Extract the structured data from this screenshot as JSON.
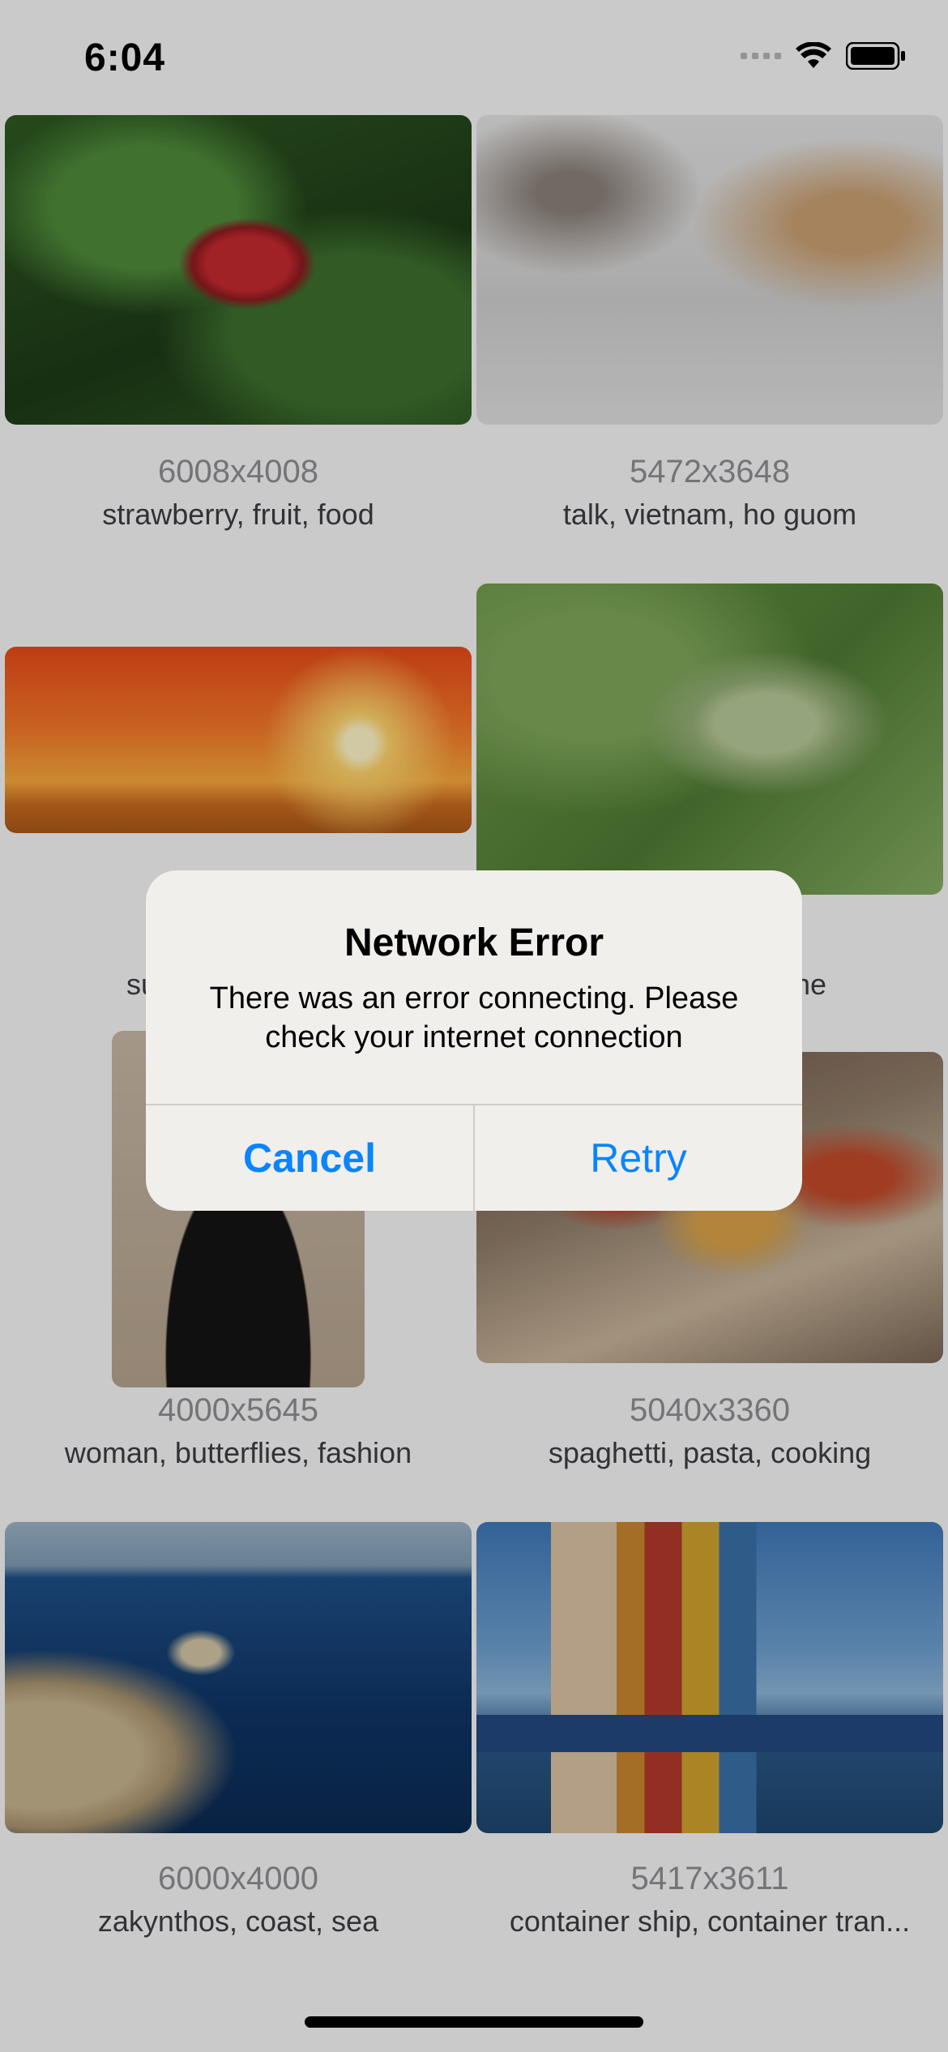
{
  "status_bar": {
    "time": "6:04",
    "icons": [
      "cellular-signal-icon",
      "wifi-icon",
      "battery-icon"
    ]
  },
  "photos": [
    {
      "dims": "6008x4008",
      "tags": "strawberry, fruit, food"
    },
    {
      "dims": "5472x3648",
      "tags": "talk, vietnam, ho guom"
    },
    {
      "dims": "",
      "tags": ""
    },
    {
      "dims": "",
      "tags": ""
    },
    {
      "dims": "4000x5645",
      "tags": "woman, butterflies, fashion"
    },
    {
      "dims": "5040x3360",
      "tags": "spaghetti, pasta, cooking"
    },
    {
      "dims": "6000x4000",
      "tags": "zakynthos, coast, sea"
    },
    {
      "dims": "5417x3611",
      "tags": "container ship, container tran..."
    }
  ],
  "partial_tag_fragments": {
    "left": "su",
    "right": "ne"
  },
  "alert": {
    "title": "Network Error",
    "message": "There was an error connecting. Please check your internet connection",
    "cancel_label": "Cancel",
    "retry_label": "Retry"
  },
  "colors": {
    "accent": "#0a84ff",
    "dims_text": "#8e8e93"
  }
}
